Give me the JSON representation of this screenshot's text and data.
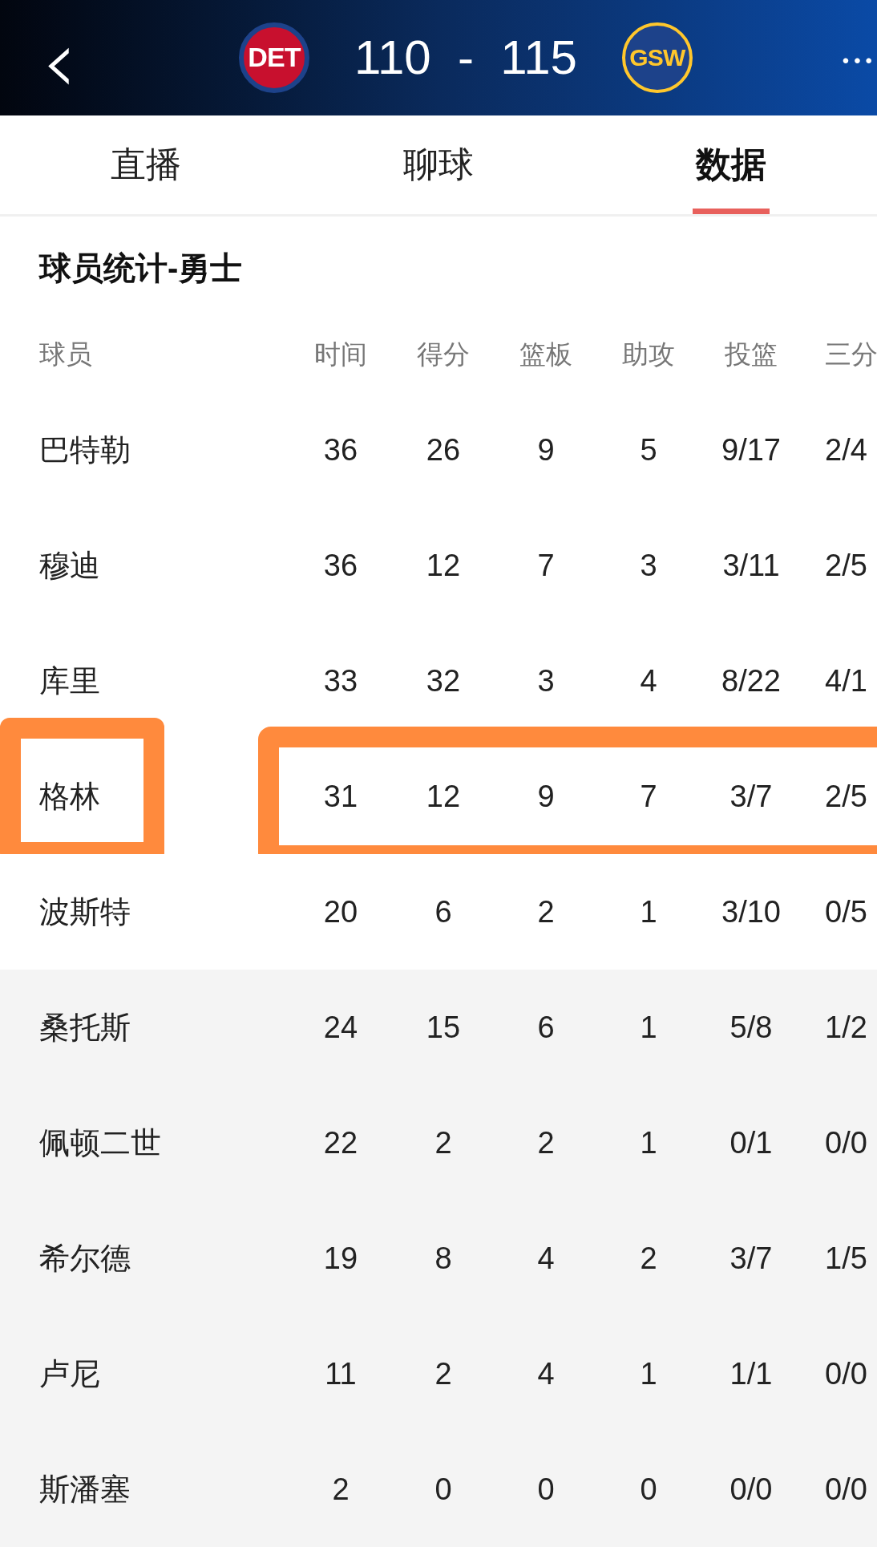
{
  "header": {
    "back": "‹",
    "home_team": "DET",
    "score": "110  -  115",
    "away_team": "GSW",
    "more": "•••"
  },
  "tabs": [
    {
      "label": "直播",
      "selected": false
    },
    {
      "label": "聊球",
      "selected": false
    },
    {
      "label": "数据",
      "selected": true
    }
  ],
  "section_title": "球员统计-勇士",
  "table": {
    "columns": [
      "球员",
      "时间",
      "得分",
      "篮板",
      "助攻",
      "投篮",
      "三分"
    ],
    "rows": [
      {
        "cells": [
          "巴特勒",
          "36",
          "26",
          "9",
          "5",
          "9/17",
          "2/4"
        ],
        "highlighted": false,
        "bench": false
      },
      {
        "cells": [
          "穆迪",
          "36",
          "12",
          "7",
          "3",
          "3/11",
          "2/5"
        ],
        "highlighted": false,
        "bench": false
      },
      {
        "cells": [
          "库里",
          "33",
          "32",
          "3",
          "4",
          "8/22",
          "4/1"
        ],
        "highlighted": false,
        "bench": false
      },
      {
        "cells": [
          "格林",
          "31",
          "12",
          "9",
          "7",
          "3/7",
          "2/5"
        ],
        "highlighted": true,
        "bench": false
      },
      {
        "cells": [
          "波斯特",
          "20",
          "6",
          "2",
          "1",
          "3/10",
          "0/5"
        ],
        "highlighted": false,
        "bench": false
      },
      {
        "cells": [
          "桑托斯",
          "24",
          "15",
          "6",
          "1",
          "5/8",
          "1/2"
        ],
        "highlighted": false,
        "bench": true
      },
      {
        "cells": [
          "佩顿二世",
          "22",
          "2",
          "2",
          "1",
          "0/1",
          "0/0"
        ],
        "highlighted": false,
        "bench": true
      },
      {
        "cells": [
          "希尔德",
          "19",
          "8",
          "4",
          "2",
          "3/7",
          "1/5"
        ],
        "highlighted": false,
        "bench": true
      },
      {
        "cells": [
          "卢尼",
          "11",
          "2",
          "4",
          "1",
          "1/1",
          "0/0"
        ],
        "highlighted": false,
        "bench": true
      },
      {
        "cells": [
          "斯潘塞",
          "2",
          "0",
          "0",
          "0",
          "0/0",
          "0/0"
        ],
        "highlighted": false,
        "bench": true
      }
    ]
  }
}
